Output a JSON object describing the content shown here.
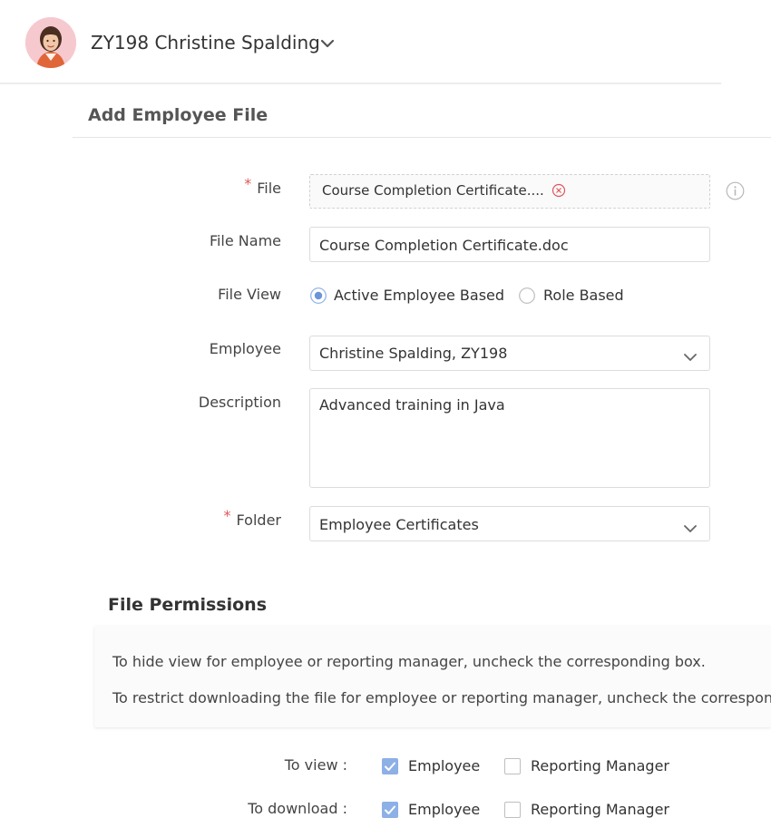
{
  "header": {
    "user_name": "ZY198 Christine Spalding"
  },
  "page": {
    "title": "Add Employee File"
  },
  "form": {
    "required_marker": "*",
    "file": {
      "label": "File",
      "chip_text": "Course Completion Certificate...."
    },
    "file_name": {
      "label": "File Name",
      "value": "Course Completion Certificate.doc"
    },
    "file_view": {
      "label": "File View",
      "options": [
        {
          "label": "Active Employee Based",
          "selected": true
        },
        {
          "label": "Role Based",
          "selected": false
        }
      ]
    },
    "employee": {
      "label": "Employee",
      "value": "Christine Spalding, ZY198"
    },
    "description": {
      "label": "Description",
      "value": "Advanced training in Java"
    },
    "folder": {
      "label": "Folder",
      "value": "Employee Certificates"
    }
  },
  "permissions": {
    "title": "File Permissions",
    "note_lines": [
      "To hide view for employee or reporting manager, uncheck the corresponding box.",
      "To restrict downloading the file for employee or reporting manager, uncheck the correspond"
    ],
    "rows": [
      {
        "label": "To view :",
        "employee": {
          "label": "Employee",
          "checked": true
        },
        "manager": {
          "label": "Reporting Manager",
          "checked": false
        }
      },
      {
        "label": "To download :",
        "employee": {
          "label": "Employee",
          "checked": true
        },
        "manager": {
          "label": "Reporting Manager",
          "checked": false
        }
      }
    ]
  },
  "colors": {
    "accent": "#8db0e6",
    "required": "#e0565b",
    "avatar_bg": "#f6c9cf"
  }
}
